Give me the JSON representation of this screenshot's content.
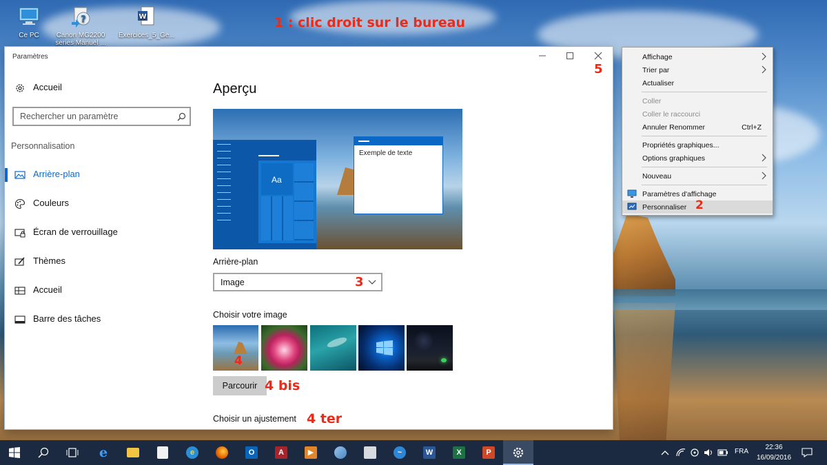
{
  "desktop": {
    "icons": [
      {
        "label": "Ce PC"
      },
      {
        "label": "Canon MG2200 series Manuel ..."
      },
      {
        "label": "Exercices_5_Ge..."
      }
    ]
  },
  "annotations": {
    "step1": "1 : clic droit sur le bureau",
    "step2": "2",
    "step3": "3",
    "step4": "4",
    "step4bis": "4 bis",
    "step4ter": "4 ter",
    "step5": "5"
  },
  "settings_window": {
    "title": "Paramètres",
    "home_label": "Accueil",
    "search_placeholder": "Rechercher un paramètre",
    "section_label": "Personnalisation",
    "nav": [
      {
        "label": "Arrière-plan",
        "icon": "picture-icon",
        "active": true
      },
      {
        "label": "Couleurs",
        "icon": "palette-icon"
      },
      {
        "label": "Écran de verrouillage",
        "icon": "lock-screen-icon"
      },
      {
        "label": "Thèmes",
        "icon": "brush-icon"
      },
      {
        "label": "Accueil",
        "icon": "start-icon"
      },
      {
        "label": "Barre des tâches",
        "icon": "taskbar-icon"
      }
    ],
    "preview": {
      "heading": "Aperçu",
      "tile_label": "Aa",
      "sample_text": "Exemple de texte"
    },
    "background": {
      "label": "Arrière-plan",
      "selected": "Image"
    },
    "choose_image_label": "Choisir votre image",
    "browse_label": "Parcourir",
    "fit_label": "Choisir un ajustement"
  },
  "context_menu": {
    "items": [
      {
        "label": "Affichage",
        "submenu": true
      },
      {
        "label": "Trier par",
        "submenu": true
      },
      {
        "label": "Actualiser"
      },
      {
        "label": "Coller",
        "disabled": true
      },
      {
        "label": "Coller le raccourci",
        "disabled": true
      },
      {
        "label": "Annuler Renommer",
        "shortcut": "Ctrl+Z"
      },
      {
        "label": "Propriétés graphiques..."
      },
      {
        "label": "Options graphiques",
        "submenu": true
      },
      {
        "label": "Nouveau",
        "submenu": true
      },
      {
        "label": "Paramètres d'affichage",
        "icon": "display-icon"
      },
      {
        "label": "Personnaliser",
        "icon": "personalize-icon",
        "highlighted": true
      }
    ]
  },
  "taskbar": {
    "language": "FRA",
    "time": "22:36",
    "date": "16/09/2016"
  },
  "colors": {
    "accent": "#0b68c6",
    "annotation": "#ee2a16",
    "taskbar": "#1b2a40"
  }
}
